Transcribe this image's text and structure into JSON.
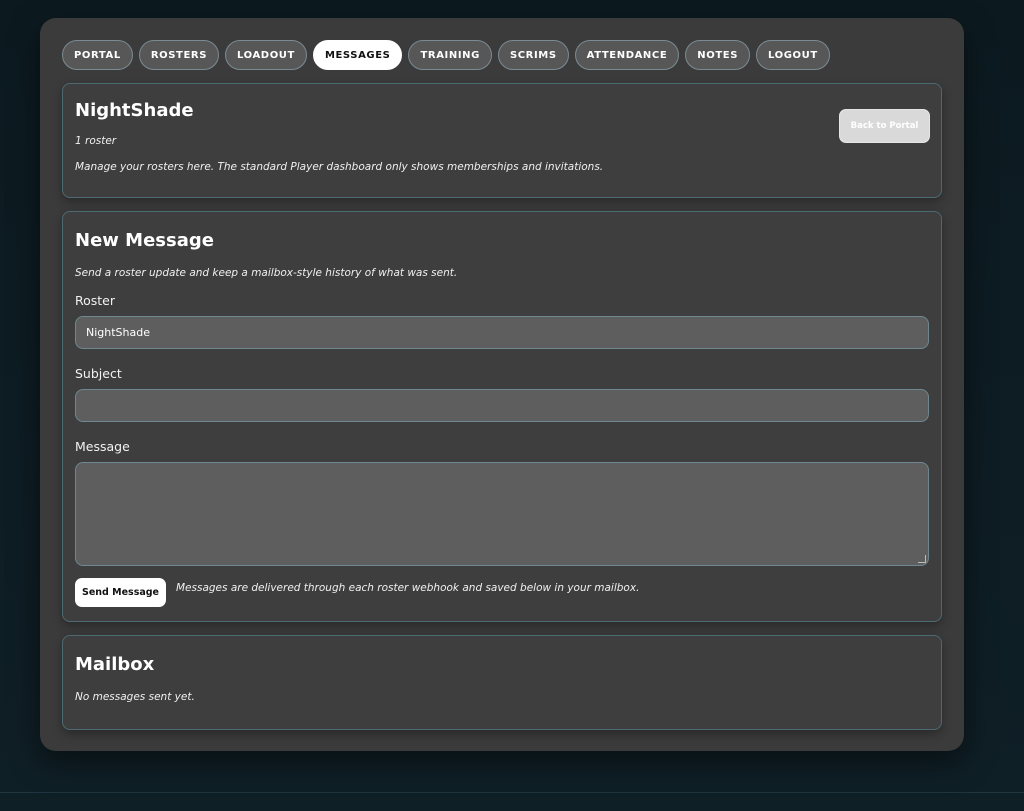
{
  "nav": {
    "tabs": [
      {
        "label": "PORTAL",
        "active": false
      },
      {
        "label": "ROSTERS",
        "active": false
      },
      {
        "label": "LOADOUT",
        "active": false
      },
      {
        "label": "MESSAGES",
        "active": true
      },
      {
        "label": "TRAINING",
        "active": false
      },
      {
        "label": "SCRIMS",
        "active": false
      },
      {
        "label": "ATTENDANCE",
        "active": false
      },
      {
        "label": "NOTES",
        "active": false
      },
      {
        "label": "LOGOUT",
        "active": false
      }
    ]
  },
  "header": {
    "title": "NightShade",
    "roster_count": "1 roster",
    "description": "Manage your rosters here. The standard Player dashboard only shows memberships and invitations.",
    "back_button": "Back to Portal"
  },
  "compose": {
    "title": "New Message",
    "lead": "Send a roster update and keep a mailbox-style history of what was sent.",
    "roster_label": "Roster",
    "roster_value": "NightShade",
    "subject_label": "Subject",
    "subject_value": "",
    "message_label": "Message",
    "message_value": "",
    "send_button": "Send Message",
    "send_note": "Messages are delivered through each roster webhook and saved below in your mailbox."
  },
  "mailbox": {
    "title": "Mailbox",
    "empty_text": "No messages sent yet."
  }
}
